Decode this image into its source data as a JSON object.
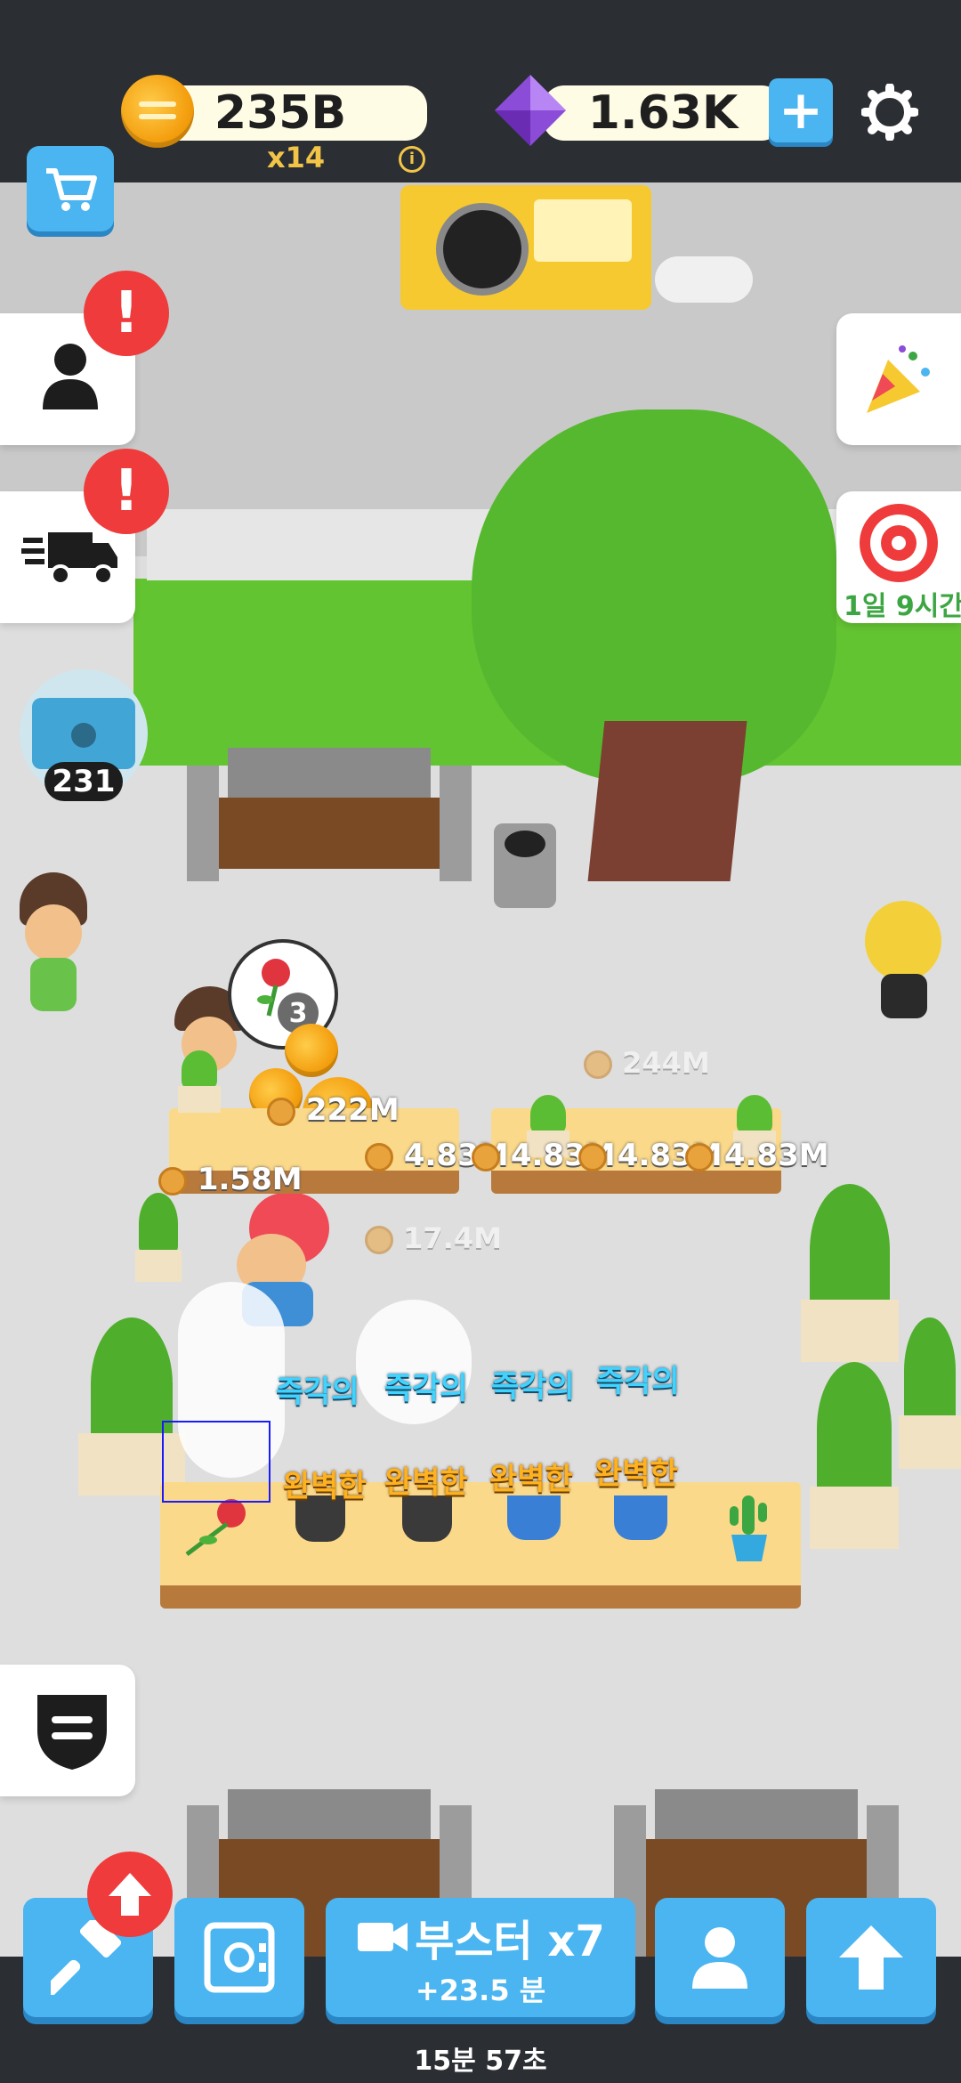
{
  "currency": {
    "coins": "235B",
    "multiplier": "x14",
    "gems": "1.63K"
  },
  "left_menu": {
    "chest_count": "231"
  },
  "right_menu": {
    "event_timer": "1일 9시간"
  },
  "order_bubble": {
    "count": "3"
  },
  "floating_values": {
    "v1": "244M",
    "v2": "222M",
    "v3": "1.58M",
    "v4": "4.83M",
    "v5": "4.83M",
    "v6": "4.83M",
    "v7": "4.83M",
    "v8": "17.4M"
  },
  "plant_labels": {
    "instant": [
      "즉각의",
      "즉각의",
      "즉각의",
      "즉각의"
    ],
    "perfect": [
      "완벽한",
      "완벽한",
      "완벽한",
      "완벽한"
    ]
  },
  "booster": {
    "label": "부스터 x7",
    "sub": "+23.5 분"
  },
  "timer": "15분 57초",
  "colors": {
    "accent_blue": "#4ab5f0",
    "alert_red": "#ef3b3b",
    "grass": "#63c432",
    "table": "#fbd98a"
  }
}
